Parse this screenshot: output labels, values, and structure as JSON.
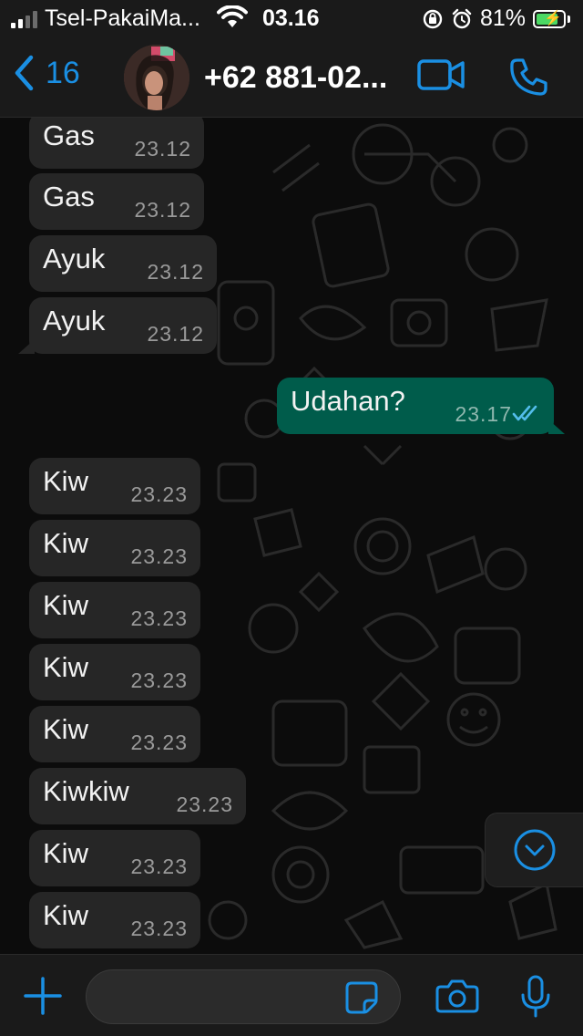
{
  "status_bar": {
    "carrier": "Tsel-PakaiMa...",
    "time": "03.16",
    "battery_percent": "81%",
    "battery_level": 0.81,
    "icons": [
      "signal-icon",
      "wifi-icon",
      "rotation-lock-icon",
      "alarm-icon",
      "battery-charging-icon"
    ]
  },
  "header": {
    "back_count": "16",
    "contact_name": "+62 881-02...",
    "icons": [
      "chevron-left-icon",
      "avatar",
      "video-call-icon",
      "phone-call-icon"
    ]
  },
  "messages": [
    {
      "text": "Gas",
      "time": "23.12",
      "direction": "in"
    },
    {
      "text": "Gas",
      "time": "23.12",
      "direction": "in"
    },
    {
      "text": "Ayuk",
      "time": "23.12",
      "direction": "in"
    },
    {
      "text": "Ayuk",
      "time": "23.12",
      "direction": "in"
    },
    {
      "text": "Udahan?",
      "time": "23.17",
      "direction": "out",
      "status": "read"
    },
    {
      "text": "Kiw",
      "time": "23.23",
      "direction": "in"
    },
    {
      "text": "Kiw",
      "time": "23.23",
      "direction": "in"
    },
    {
      "text": "Kiw",
      "time": "23.23",
      "direction": "in"
    },
    {
      "text": "Kiw",
      "time": "23.23",
      "direction": "in"
    },
    {
      "text": "Kiw",
      "time": "23.23",
      "direction": "in"
    },
    {
      "text": "Kiwkiw",
      "time": "23.23",
      "direction": "in"
    },
    {
      "text": "Kiw",
      "time": "23.23",
      "direction": "in"
    },
    {
      "text": "Kiw",
      "time": "23.23",
      "direction": "in"
    }
  ],
  "input_bar": {
    "value": "",
    "placeholder": "",
    "icons": [
      "plus-icon",
      "sticker-icon",
      "camera-icon",
      "microphone-icon"
    ]
  },
  "colors": {
    "accent": "#1a8fe3",
    "incoming_bubble": "#262626",
    "outgoing_bubble": "#005c4b",
    "read_ticks": "#53bdeb",
    "battery_fill": "#4cd964"
  }
}
